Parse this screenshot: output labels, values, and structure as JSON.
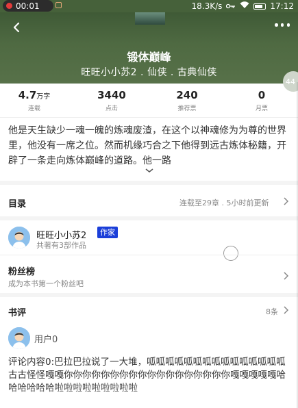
{
  "status_bar": {
    "time_pill": "00:01",
    "net_speed": "18.3K/s",
    "clock": "17:12"
  },
  "header": {
    "title": "锻体巅峰",
    "meta": "旺旺小小苏2 . 仙侠 . 古典仙侠",
    "badge": "44"
  },
  "stats": [
    {
      "value": "4.7",
      "unit": "万字",
      "label": "连载"
    },
    {
      "value": "3440",
      "unit": "",
      "label": "点击"
    },
    {
      "value": "240",
      "unit": "",
      "label": "推荐票"
    },
    {
      "value": "0",
      "unit": "",
      "label": "月票"
    }
  ],
  "intro": "他是天生缺少一魂一魄的炼魂废渣，在这个以神魂修为为尊的世界里，他没有一席之位。然而机缘巧合之下他得到远古炼体秘籍，开辟了一条走向炼体巅峰的道路。他一路",
  "catalog": {
    "title": "目录",
    "status": "连载至29章 . 5小时前更新"
  },
  "author": {
    "name": "旺旺小小苏2",
    "badge": "作家",
    "works": "共著有3部作品"
  },
  "fans": {
    "title": "粉丝榜",
    "sub": "成为本书第一个粉丝吧"
  },
  "reviews": {
    "title": "书评",
    "count": "8条",
    "user": "用户0",
    "content": "评论内容0:巴拉巴拉说了一大堆，呱呱呱呱呱呱呱呱呱呱呱呱呱呱呱古古怪怪嘎嘎你你你你你你你你你你你你你你你你你你嘎嘎嘎嘎嘎哈哈哈哈哈哈啦啦啦啦啦啦啦啦啦"
  },
  "colors": {
    "header_bg": "#4f6a42",
    "badge_blue": "#1b3fd9"
  },
  "icons": [
    "back-arrow-icon",
    "more-dots-icon",
    "chevron-down-icon",
    "chevron-right-icon",
    "avatar-icon",
    "wifi-icon",
    "key-icon",
    "battery-icon"
  ]
}
